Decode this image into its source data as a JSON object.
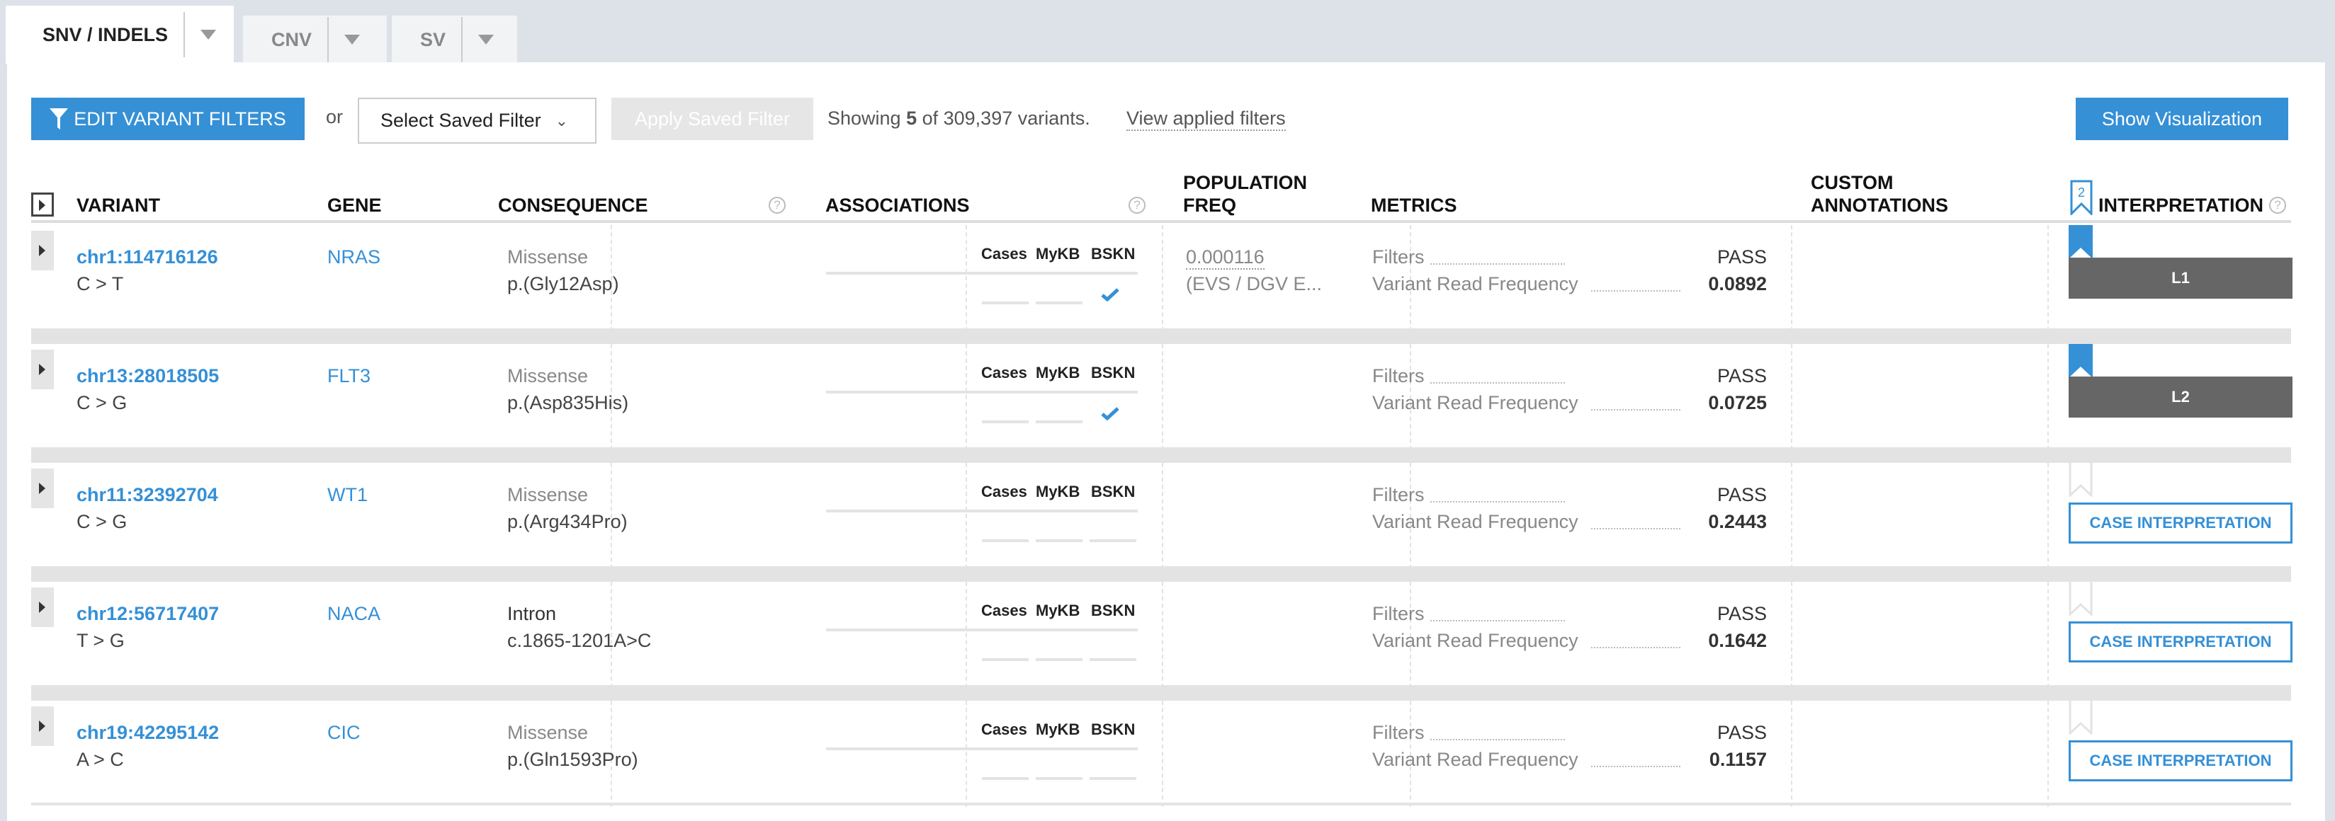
{
  "tabs": [
    {
      "label": "SNV / INDELS",
      "active": true
    },
    {
      "label": "CNV",
      "active": false
    },
    {
      "label": "SV",
      "active": false
    }
  ],
  "toolbar": {
    "edit_filters": "EDIT VARIANT FILTERS",
    "or": "or",
    "saved_filter_placeholder": "Select Saved Filter",
    "apply_saved": "Apply Saved Filter",
    "showing_prefix": "Showing ",
    "showing_count": "5",
    "showing_suffix": " of 309,397 variants.",
    "view_applied": "View applied filters",
    "show_visualization": "Show Visualization"
  },
  "headers": {
    "variant": "VARIANT",
    "gene": "GENE",
    "consequence": "CONSEQUENCE",
    "associations": "ASSOCIATIONS",
    "pop_freq_1": "POPULATION",
    "pop_freq_2": "FREQ",
    "metrics": "METRICS",
    "custom_1": "CUSTOM",
    "custom_2": "ANNOTATIONS",
    "interpretation": "INTERPRETATION",
    "interp_count": "2"
  },
  "assoc_labels": [
    "Cases",
    "MyKB",
    "BSKN"
  ],
  "metric_labels": {
    "filters": "Filters",
    "vrf": "Variant Read Frequency"
  },
  "colors": {
    "accent": "#3590d6",
    "level_bg": "#666666"
  },
  "rows": [
    {
      "variant": "chr1:114716126",
      "change": "C > T",
      "gene": "NRAS",
      "consequence": "Missense",
      "protein": "p.(Gly12Asp)",
      "cons_gray": true,
      "bskn_check": true,
      "pop_freq": "0.000116",
      "pop_source": "(EVS / DGV E...",
      "filters": "PASS",
      "vrf": "0.0892",
      "interp": "L1",
      "ribbon": "filled"
    },
    {
      "variant": "chr13:28018505",
      "change": "C > G",
      "gene": "FLT3",
      "consequence": "Missense",
      "protein": "p.(Asp835His)",
      "cons_gray": true,
      "bskn_check": true,
      "pop_freq": "",
      "pop_source": "",
      "filters": "PASS",
      "vrf": "0.0725",
      "interp": "L2",
      "ribbon": "filled"
    },
    {
      "variant": "chr11:32392704",
      "change": "C > G",
      "gene": "WT1",
      "consequence": "Missense",
      "protein": "p.(Arg434Pro)",
      "cons_gray": true,
      "bskn_check": false,
      "pop_freq": "",
      "pop_source": "",
      "filters": "PASS",
      "vrf": "0.2443",
      "interp": "CASE INTERPRETATION",
      "ribbon": "empty"
    },
    {
      "variant": "chr12:56717407",
      "change": "T > G",
      "gene": "NACA",
      "consequence": "Intron",
      "protein": "c.1865-1201A>C",
      "cons_gray": false,
      "bskn_check": false,
      "pop_freq": "",
      "pop_source": "",
      "filters": "PASS",
      "vrf": "0.1642",
      "interp": "CASE INTERPRETATION",
      "ribbon": "empty"
    },
    {
      "variant": "chr19:42295142",
      "change": "A > C",
      "gene": "CIC",
      "consequence": "Missense",
      "protein": "p.(Gln1593Pro)",
      "cons_gray": true,
      "bskn_check": false,
      "pop_freq": "",
      "pop_source": "",
      "filters": "PASS",
      "vrf": "0.1157",
      "interp": "CASE INTERPRETATION",
      "ribbon": "empty"
    }
  ]
}
